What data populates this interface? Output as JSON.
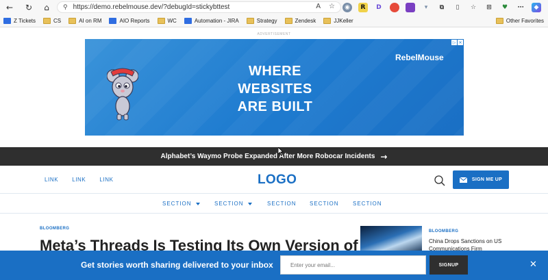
{
  "browser": {
    "url": "https://demo.rebelmouse.dev/?debugId=stickybttest",
    "nav": {
      "back": "←",
      "reload": "↻",
      "home": "⌂"
    },
    "extensions": [
      "R",
      "D"
    ]
  },
  "bookmarks": {
    "items": [
      {
        "label": "Z Tickets",
        "icon": "jira-icon"
      },
      {
        "label": "CS",
        "icon": "folder-icon"
      },
      {
        "label": "AI on RM",
        "icon": "folder-icon"
      },
      {
        "label": "AIO Reports",
        "icon": "jira-icon"
      },
      {
        "label": "WC",
        "icon": "folder-icon"
      },
      {
        "label": "Automation - JIRA",
        "icon": "jira-icon"
      },
      {
        "label": "Strategy",
        "icon": "folder-icon"
      },
      {
        "label": "Zendesk",
        "icon": "folder-icon"
      },
      {
        "label": "JJKeller",
        "icon": "folder-icon"
      }
    ],
    "other": "Other Favorites"
  },
  "ad": {
    "label": "ADVERTISEMENT",
    "line1": "WHERE",
    "line2": "WEBSITES",
    "line3": "ARE BUILT",
    "brand": "RebelMouse"
  },
  "breaking": {
    "text": "Alphabet’s Waymo Probe Expanded After More Robocar Incidents",
    "arrow": "→"
  },
  "header": {
    "links": [
      "LINK",
      "LINK",
      "LINK"
    ],
    "logo": "LOGO",
    "signup": "SIGN ME UP"
  },
  "sections": [
    "SECTION",
    "SECTION",
    "SECTION",
    "SECTION",
    "SECTION"
  ],
  "article": {
    "kicker": "BLOOMBERG",
    "headline": "Meta’s Threads Is Testing Its Own Version of"
  },
  "side_article": {
    "kicker": "BLOOMBERG",
    "title": "China Drops Sanctions on US Communications Firm"
  },
  "newsletter": {
    "text": "Get stories worth sharing delivered to your inbox",
    "placeholder": "Enter your email...",
    "button": "SIGNUP",
    "close": "✕"
  },
  "colors": {
    "brand_blue": "#1a6fc4",
    "dark_bar": "#2f2f2f"
  }
}
